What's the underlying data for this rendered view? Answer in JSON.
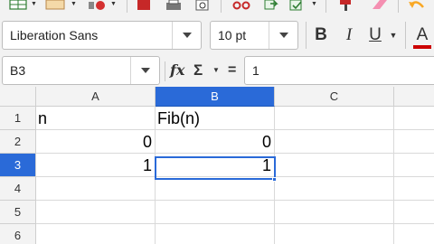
{
  "app": {
    "accent": "#2a6ad8"
  },
  "toolbar_top": {
    "icons": [
      "table-icon",
      "image-icon",
      "chart-icon",
      "pdf-icon",
      "print-icon",
      "cut-icon",
      "copy-icon",
      "paste-icon",
      "clone-format-icon",
      "clear-format-icon",
      "undo-icon"
    ]
  },
  "toolbar_font": {
    "font_name": "Liberation Sans",
    "font_size": "10 pt",
    "bold_label": "B",
    "italic_label": "I",
    "underline_label": "U",
    "font_color_label": "A",
    "font_color": "#cc0000"
  },
  "formula_bar": {
    "name_box": "B3",
    "function_wizard_label": "fx",
    "sum_label": "Σ",
    "formula_label": "=",
    "content": "1"
  },
  "sheet": {
    "columns": [
      "A",
      "B",
      "C"
    ],
    "active_column": "B",
    "rows": [
      "1",
      "2",
      "3",
      "4",
      "5",
      "6"
    ],
    "active_row": "3",
    "cells": {
      "A1": "n",
      "B1": "Fib(n)",
      "A2": "0",
      "B2": "0",
      "A3": "1",
      "B3": "1"
    },
    "selected_cell": "B3"
  }
}
